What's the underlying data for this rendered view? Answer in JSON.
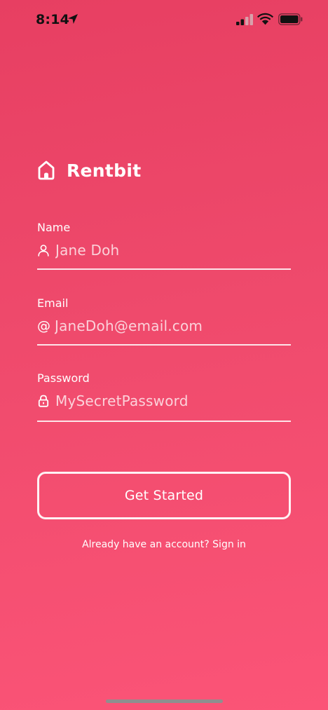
{
  "status_bar": {
    "time": "8:14",
    "location_icon": "location-arrow-icon",
    "signal_icon": "cellular-signal-icon",
    "wifi_icon": "wifi-icon",
    "battery_icon": "battery-icon"
  },
  "brand": {
    "name": "Rentbit",
    "icon": "home-icon"
  },
  "form": {
    "name": {
      "label": "Name",
      "placeholder": "Jane Doh",
      "icon": "user-icon"
    },
    "email": {
      "label": "Email",
      "placeholder": "JaneDoh@email.com",
      "icon_glyph": "@",
      "icon": "at-icon"
    },
    "password": {
      "label": "Password",
      "placeholder": "MySecretPassword",
      "icon": "lock-icon"
    }
  },
  "actions": {
    "get_started_label": "Get Started",
    "signin_text": "Already have an account? Sign in"
  },
  "colors": {
    "background_top": "#e73f62",
    "background_bottom": "#fb5477",
    "foreground": "#ffffff"
  }
}
